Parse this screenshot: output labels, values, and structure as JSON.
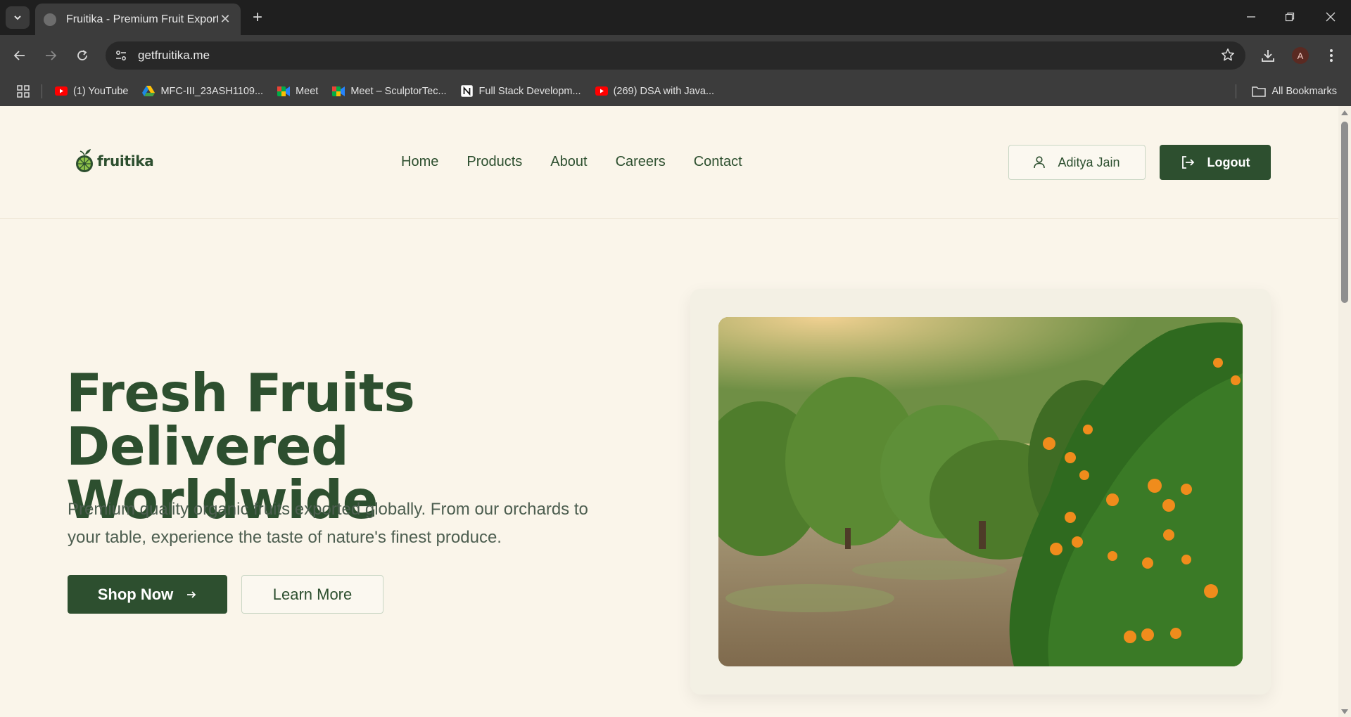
{
  "browser": {
    "tab_title": "Fruitika - Premium Fruit Exports",
    "url": "getfruitika.me",
    "profile_initial": "A",
    "bookmarks": [
      {
        "label": "(1) YouTube",
        "icon": "youtube-icon"
      },
      {
        "label": "MFC-III_23ASH1109...",
        "icon": "google-drive-icon"
      },
      {
        "label": "Meet",
        "icon": "google-meet-icon"
      },
      {
        "label": "Meet – SculptorTec...",
        "icon": "google-meet-icon"
      },
      {
        "label": "Full Stack Developm...",
        "icon": "notion-icon"
      },
      {
        "label": "(269) DSA with Java...",
        "icon": "youtube-icon"
      }
    ],
    "all_bookmarks_label": "All Bookmarks"
  },
  "site": {
    "logo_text": "fruitika",
    "nav": [
      "Home",
      "Products",
      "About",
      "Careers",
      "Contact"
    ],
    "user_name": "Aditya Jain",
    "logout_label": "Logout"
  },
  "hero": {
    "title_line1": "Fresh Fruits Delivered",
    "title_line2": "Worldwide",
    "subtitle_line1": "Premium quality organic fruits exported globally. From our orchards to",
    "subtitle_line2": "your table, experience the taste of nature's finest produce.",
    "primary_cta": "Shop Now",
    "secondary_cta": "Learn More"
  },
  "colors": {
    "brand_green": "#2d4f2f",
    "page_background": "#faf5ea",
    "chrome_dark": "#1f1f1f"
  }
}
